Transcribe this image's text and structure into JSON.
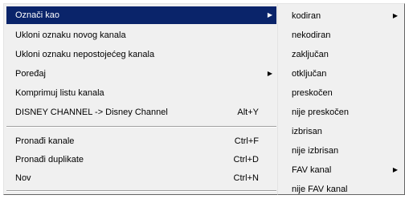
{
  "main_menu": {
    "items": [
      {
        "label": "Označi kao",
        "has_submenu": true
      },
      {
        "label": "Ukloni oznaku novog kanala"
      },
      {
        "label": "Ukloni oznaku nepostojećeg kanala"
      },
      {
        "label": "Poređaj",
        "has_submenu": true
      },
      {
        "label": "Komprimuj listu kanala"
      },
      {
        "label": "DISNEY CHANNEL -> Disney Channel",
        "shortcut": "Alt+Y"
      },
      {
        "label": "Pronađi kanale",
        "shortcut": "Ctrl+F"
      },
      {
        "label": "Pronađi duplikate",
        "shortcut": "Ctrl+D"
      },
      {
        "label": "Nov",
        "shortcut": "Ctrl+N"
      }
    ]
  },
  "sub_menu": {
    "items": [
      {
        "label": "kodiran",
        "has_submenu": true
      },
      {
        "label": "nekodiran"
      },
      {
        "label": "zaključan"
      },
      {
        "label": "otključan"
      },
      {
        "label": "preskočen"
      },
      {
        "label": "nije preskočen"
      },
      {
        "label": "izbrisan"
      },
      {
        "label": "nije izbrisan"
      },
      {
        "label": "FAV kanal",
        "has_submenu": true
      },
      {
        "label": "nije FAV kanal"
      }
    ]
  },
  "colors": {
    "highlight": "#0a246a",
    "menu_bg": "#f0f0f0"
  },
  "icons": {
    "submenu_arrow": "▶"
  }
}
